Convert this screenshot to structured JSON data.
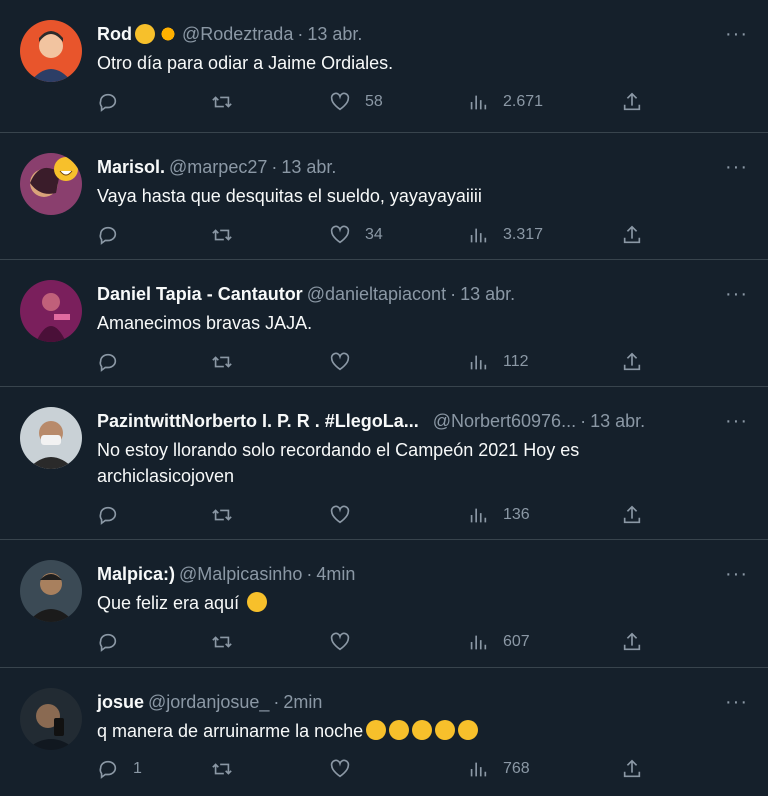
{
  "tweets": [
    {
      "name": "Rod",
      "handle": "@Rodeztrada",
      "time": "13 abr.",
      "text": "Otro día para odiar a Jaime Ordiales.",
      "replies": "",
      "retweets": "",
      "likes": "58",
      "views": "2.671",
      "avatar_color": "#e8552c"
    },
    {
      "name": "Marisol.",
      "handle": "@marpec27",
      "time": "13 abr.",
      "text": "Vaya hasta que desquitas el sueldo, yayayayaiiii",
      "replies": "",
      "retweets": "",
      "likes": "34",
      "views": "3.317",
      "avatar_color": "#8a3f6e"
    },
    {
      "name": "Daniel Tapia - Cantautor",
      "handle": "@danieltapiacont",
      "time": "13 abr.",
      "text": "Amanecimos bravas JAJA.",
      "replies": "",
      "retweets": "",
      "likes": "",
      "views": "112",
      "avatar_color": "#7a1f5c"
    },
    {
      "name": "PazintwittNorberto I. P. R . #LlegoLa...",
      "handle": "@Norbert60976...",
      "time": "13 abr.",
      "text": "No estoy llorando solo recordando el Campeón 2021 Hoy es archiclasicojoven",
      "replies": "",
      "retweets": "",
      "likes": "",
      "views": "136",
      "avatar_color": "#c9d1d6"
    },
    {
      "name": "Malpica:)",
      "handle": "@Malpicasinho",
      "time": "4min",
      "text": "Que feliz era aquí",
      "replies": "",
      "retweets": "",
      "likes": "",
      "views": "607",
      "avatar_color": "#3b4a55"
    },
    {
      "name": "josue",
      "handle": "@jordanjosue_",
      "time": "2min",
      "text": "q manera de arruinarme la noche",
      "replies": "1",
      "retweets": "",
      "likes": "",
      "views": "768",
      "avatar_color": "#222b33"
    }
  ],
  "more_label": "···",
  "icons": {
    "reply": "reply-icon",
    "retweet": "retweet-icon",
    "like": "heart-icon",
    "views": "views-icon",
    "share": "share-icon"
  }
}
